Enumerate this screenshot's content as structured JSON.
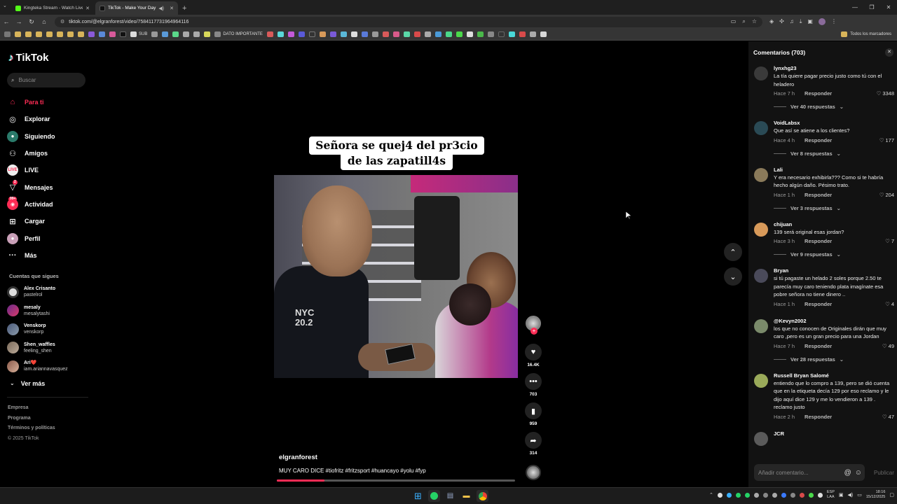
{
  "browser": {
    "tabs": [
      {
        "title": "Kingteka Stream - Watch Live o",
        "active": false
      },
      {
        "title": "TikTok - Make Your Day",
        "active": true
      }
    ],
    "url": "tiktok.com/@elgranforest/video/7584117731964964116",
    "bookmarks": [
      {
        "label": "SUB"
      },
      {
        "label": "DATO IMPORTANTE"
      }
    ],
    "all_bookmarks": "Todos los marcadores"
  },
  "sidebar": {
    "logo": "TikTok",
    "search_placeholder": "Buscar",
    "nav": [
      {
        "label": "Para ti",
        "icon": "home-icon",
        "active": true
      },
      {
        "label": "Explorar",
        "icon": "compass-icon"
      },
      {
        "label": "Siguiendo",
        "icon": "following-icon"
      },
      {
        "label": "Amigos",
        "icon": "friends-icon"
      },
      {
        "label": "LIVE",
        "icon": "live-icon"
      },
      {
        "label": "Mensajes",
        "icon": "messages-icon",
        "badge": "2"
      },
      {
        "label": "Actividad",
        "icon": "activity-icon",
        "badge": "99+"
      },
      {
        "label": "Cargar",
        "icon": "upload-icon"
      },
      {
        "label": "Perfil",
        "icon": "profile-icon"
      },
      {
        "label": "Más",
        "icon": "more-icon"
      }
    ],
    "following_heading": "Cuentas que sigues",
    "following": [
      {
        "name": "Alex Crisanto",
        "handle": "pastelrol"
      },
      {
        "name": "mesaly",
        "handle": "mesalytashi"
      },
      {
        "name": "Venskorp",
        "handle": "venskorp"
      },
      {
        "name": "Shen_waffles",
        "handle": "feeling_shen"
      },
      {
        "name": "Ari❤️",
        "handle": "iam.ariannavasquez"
      }
    ],
    "see_more": "Ver más",
    "footer": [
      "Empresa",
      "Programa",
      "Términos y políticas",
      "© 2025 TikTok"
    ]
  },
  "video": {
    "caption_line1": "Señora se quej4 del pr3cio",
    "caption_line2": "de las zapatill4s",
    "shirt_text": "NYC\n20.2",
    "author": "elgranforest",
    "description": "MUY CARO DICE #tiofritz #fritzsport #huancayo #yolu #fyp",
    "progress": 0.2,
    "likes": "16.4K",
    "comments": "703",
    "saves": "959",
    "shares": "314"
  },
  "comments_panel": {
    "title": "Comentarios (703)",
    "input_placeholder": "Añadir comentario...",
    "post_label": "Publicar",
    "reply_label": "Responder",
    "items": [
      {
        "user": "lynxhg23",
        "text": "La tía quiere pagar precio justo como tú con el heladero",
        "time": "Hace 7 h",
        "likes": "3348",
        "replies": "Ver 40 respuestas",
        "avatar": "#3a3a3a"
      },
      {
        "user": "VoidLabsx",
        "text": "Que así se atiene a los clientes?",
        "time": "Hace 4 h",
        "likes": "177",
        "replies": "Ver 8 respuestas",
        "avatar": "#2a4a55"
      },
      {
        "user": "Lali",
        "text": "Y era necesario exhibirla??? Como si te habría hecho algún daño. Pésimo trato.",
        "time": "Hace 1 h",
        "likes": "204",
        "replies": "Ver 3 respuestas",
        "avatar": "#8a7a5a"
      },
      {
        "user": "chijuan",
        "text": "139 será original esas jordan?",
        "time": "Hace 3 h",
        "likes": "7",
        "replies": "Ver 9 respuestas",
        "avatar": "#d89a5a"
      },
      {
        "user": "Bryan",
        "text": "si tú pagaste un helado 2 soles porque 2.50 te parecía muy caro teniendo plata imagínate esa pobre señora no tiene dinero ..",
        "time": "Hace 1 h",
        "likes": "4",
        "replies": "",
        "avatar": "#4a4a5a"
      },
      {
        "user": "@Kevyn2002",
        "text": "los que no conocen de Originales dirán que muy caro ,pero es un gran precio para una Jordan",
        "time": "Hace 7 h",
        "likes": "49",
        "replies": "Ver 28 respuestas",
        "avatar": "#7a8a6a"
      },
      {
        "user": "Russell Bryan Salomé",
        "text": "entiendo que lo compro a 139, pero se dió cuenta que en la etiqueta decía 129 por eso reclamo y le dijo aquí dice 129 y me lo vendieron a 139 . reclamo justo",
        "time": "Hace 2 h",
        "likes": "47",
        "replies": "",
        "avatar": "#9aaa5a"
      },
      {
        "user": "JCR",
        "text": "",
        "time": "",
        "likes": "",
        "replies": "",
        "avatar": "#5a5a5a"
      }
    ]
  },
  "taskbar": {
    "lang": "ESP\nLAA",
    "time": "18:16",
    "date": "15/12/2025"
  },
  "colors": {
    "accent": "#fe2c55",
    "background": "#000000",
    "panel": "#121212"
  }
}
